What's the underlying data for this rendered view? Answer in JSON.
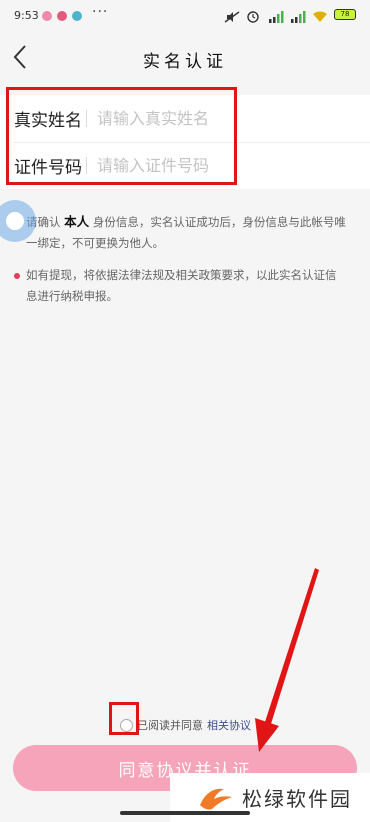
{
  "status_bar": {
    "time": "9:53",
    "more": "···",
    "battery": "78",
    "colors": {
      "app1": "#f08aa8",
      "app2": "#e25b7e",
      "app3": "#4cb6c8"
    }
  },
  "nav": {
    "title": "实名认证"
  },
  "form": {
    "name_label": "真实姓名",
    "name_placeholder": "请输入真实姓名",
    "id_label": "证件号码",
    "id_placeholder": "请输入证件号码"
  },
  "notices": {
    "n1_prefix": "请确认",
    "n1_bold": "本人",
    "n1_suffix": "身份信息，实名认证成功后，身份信息与此帐号唯",
    "n1_line2": "一绑定，不可更换为他人。",
    "n2_line1": "如有提现，将依据法律法规及相关政策要求，以此实名认证信",
    "n2_line2": "息进行纳税申报。"
  },
  "agreement": {
    "text": "已阅读并同意",
    "link": "相关协议"
  },
  "submit": {
    "label": "同意协议并认证"
  },
  "watermark": {
    "text": "松绿软件园"
  },
  "colors": {
    "accent_pink": "#f6a4b9",
    "annotation_red": "#e11515",
    "bullet_pink": "#e83a5c",
    "link_blue": "#3d4e8a"
  }
}
